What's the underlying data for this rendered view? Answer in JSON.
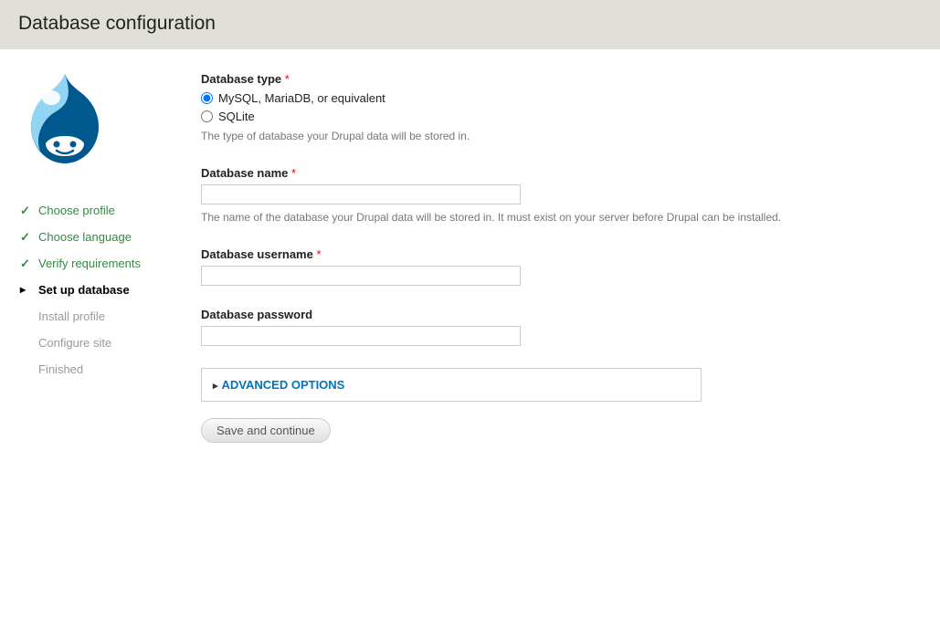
{
  "header": {
    "title": "Database configuration"
  },
  "steps": [
    {
      "label": "Choose profile",
      "state": "done"
    },
    {
      "label": "Choose language",
      "state": "done"
    },
    {
      "label": "Verify requirements",
      "state": "done"
    },
    {
      "label": "Set up database",
      "state": "active"
    },
    {
      "label": "Install profile",
      "state": "pending"
    },
    {
      "label": "Configure site",
      "state": "pending"
    },
    {
      "label": "Finished",
      "state": "pending"
    }
  ],
  "form": {
    "dbtype": {
      "label": "Database type",
      "required": "*",
      "options": [
        {
          "label": "MySQL, MariaDB, or equivalent",
          "checked": true
        },
        {
          "label": "SQLite",
          "checked": false
        }
      ],
      "description": "The type of database your Drupal data will be stored in."
    },
    "dbname": {
      "label": "Database name",
      "required": "*",
      "value": "",
      "description": "The name of the database your Drupal data will be stored in. It must exist on your server before Drupal can be installed."
    },
    "dbuser": {
      "label": "Database username",
      "required": "*",
      "value": ""
    },
    "dbpass": {
      "label": "Database password",
      "value": ""
    },
    "advanced": {
      "title": "Advanced Options"
    },
    "submit": {
      "label": "Save and continue"
    }
  }
}
